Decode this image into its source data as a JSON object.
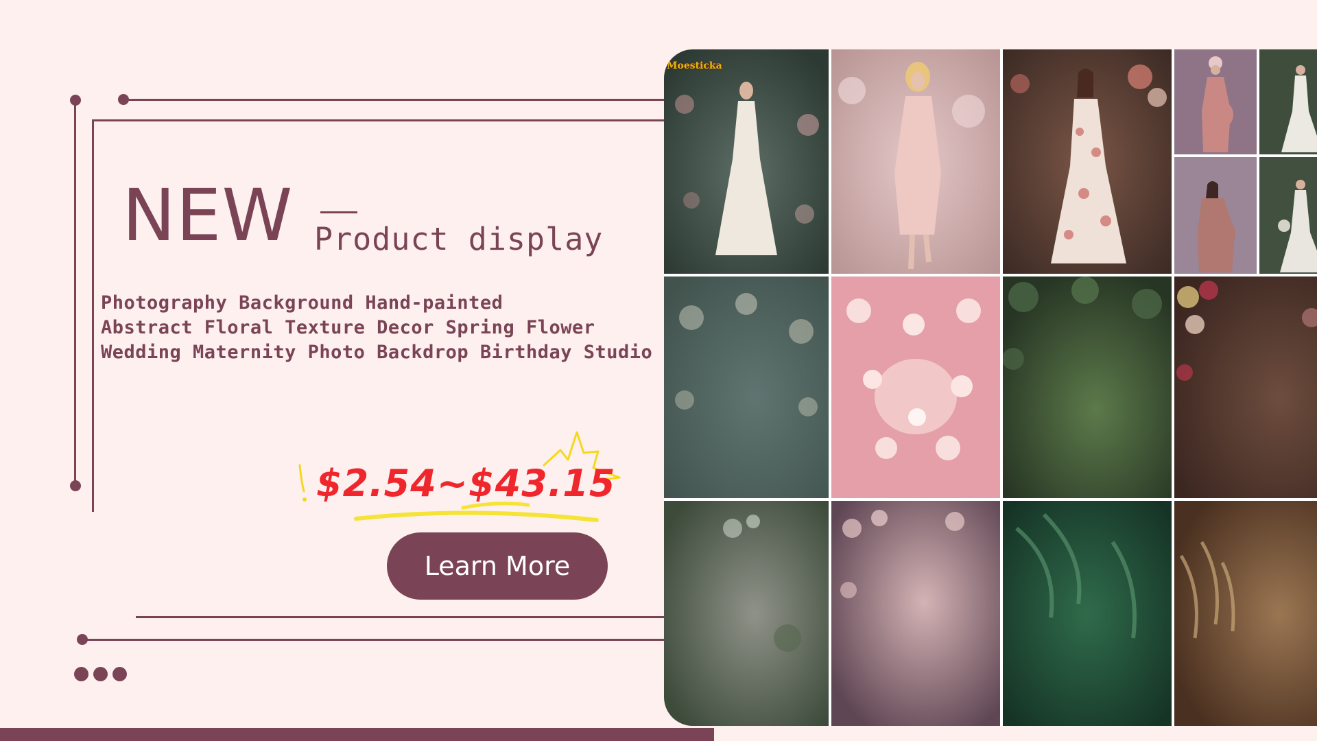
{
  "banner": {
    "headline": "NEW",
    "subhead": "Product display",
    "description_lines": [
      "Photography Background Hand-painted",
      "Abstract Floral Texture Decor Spring Flower",
      "Wedding Maternity Photo Backdrop Birthday Studio"
    ],
    "price_range": "$2.54~$43.15",
    "cta_label": "Learn More"
  },
  "gallery": {
    "brand_tag": "Moesticka",
    "tiles": [
      {
        "name": "green-floral-arch-bride",
        "subject": "woman-in-white-gown"
      },
      {
        "name": "pink-soft-portrait",
        "subject": "blonde-woman-pink-dress"
      },
      {
        "name": "brown-rose-portrait",
        "subject": "woman-floral-dress"
      },
      {
        "name": "purple-maternity-1",
        "subject": "pregnant-woman"
      },
      {
        "name": "green-bride-1",
        "subject": "bride-white-dress"
      },
      {
        "name": "purple-maternity-2",
        "subject": "pregnant-woman"
      },
      {
        "name": "green-bride-2",
        "subject": "bride-white-dress"
      },
      {
        "name": "sage-floral-texture",
        "subject": "backdrop"
      },
      {
        "name": "pink-blossom-texture",
        "subject": "backdrop"
      },
      {
        "name": "green-leaf-texture",
        "subject": "backdrop"
      },
      {
        "name": "brown-rose-texture",
        "subject": "backdrop"
      },
      {
        "name": "misty-green-texture",
        "subject": "backdrop"
      },
      {
        "name": "mauve-blossom-texture",
        "subject": "backdrop"
      },
      {
        "name": "emerald-fern-texture",
        "subject": "backdrop"
      },
      {
        "name": "golden-wheat-texture",
        "subject": "backdrop"
      }
    ]
  },
  "colors": {
    "background": "#fdf0ee",
    "accent": "#7a4456",
    "price": "#f0262d",
    "highlight": "#f5e335"
  }
}
